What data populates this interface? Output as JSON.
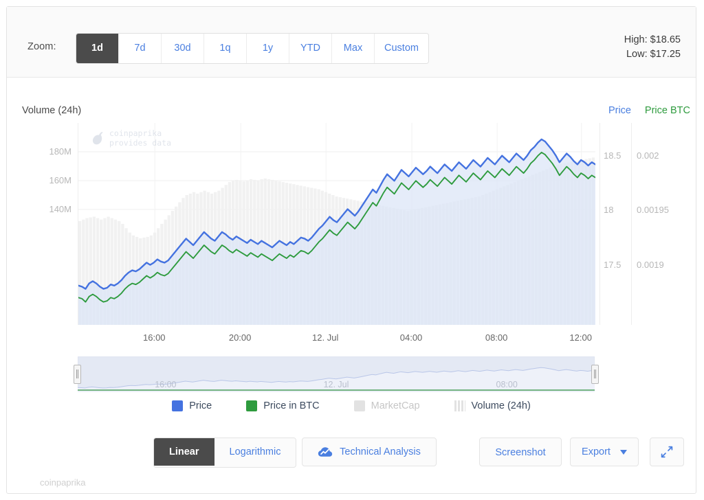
{
  "zoom_bar": {
    "label": "Zoom:",
    "ranges": [
      {
        "label": "1d",
        "active": true
      },
      {
        "label": "7d",
        "active": false
      },
      {
        "label": "30d",
        "active": false
      },
      {
        "label": "1q",
        "active": false
      },
      {
        "label": "1y",
        "active": false
      },
      {
        "label": "YTD",
        "active": false
      },
      {
        "label": "Max",
        "active": false
      },
      {
        "label": "Custom",
        "active": false
      }
    ],
    "high": "High: $18.65",
    "low": "Low: $17.25"
  },
  "chart_titles": {
    "volume_axis": "Volume (24h)",
    "price_axis": "Price",
    "price_btc_axis": "Price BTC"
  },
  "watermark": {
    "line1": "coinpaprika",
    "line2": "provides data"
  },
  "legend": [
    {
      "label": "Price",
      "color": "#4472e0",
      "type": "square",
      "disabled": false
    },
    {
      "label": "Price in BTC",
      "color": "#2e9b3e",
      "type": "square",
      "disabled": false
    },
    {
      "label": "MarketCap",
      "color": "#e2e2e2",
      "type": "square",
      "disabled": true
    },
    {
      "label": "Volume (24h)",
      "color": "#e2e2e2",
      "type": "bars",
      "disabled": false
    }
  ],
  "toolbar": {
    "scale_modes": [
      {
        "label": "Linear",
        "active": true
      },
      {
        "label": "Logarithmic",
        "active": false
      }
    ],
    "technical_analysis": "Technical Analysis",
    "screenshot": "Screenshot",
    "export": "Export",
    "fullscreen_icon": "expand-arrows-icon"
  },
  "credit": "coinpaprika",
  "chart_data": {
    "type": "line",
    "title": "",
    "xlabel": "",
    "grid": true,
    "legend_position": "bottom",
    "x_ticks": [
      "16:00",
      "20:00",
      "12. Jul",
      "04:00",
      "08:00",
      "12:00"
    ],
    "x_tick_positions": [
      0.148,
      0.314,
      0.479,
      0.645,
      0.81,
      0.973
    ],
    "axes": {
      "volume": {
        "label": "Volume (24h)",
        "ticks": [
          "140M",
          "160M",
          "180M"
        ],
        "tick_values": [
          140000000,
          160000000,
          180000000
        ],
        "range": [
          60000000,
          200000000
        ],
        "side": "left"
      },
      "price": {
        "label": "Price",
        "ticks": [
          "17.5",
          "18",
          "18.5"
        ],
        "tick_values": [
          17.5,
          18,
          18.5
        ],
        "range": [
          16.95,
          18.8
        ],
        "side": "right",
        "color": "#4472e0"
      },
      "price_btc": {
        "label": "Price BTC",
        "ticks": [
          "0.0019",
          "0.00195",
          "0.002"
        ],
        "tick_values": [
          0.0019,
          0.00195,
          0.002
        ],
        "range": [
          0.001845,
          0.00203
        ],
        "side": "right",
        "color": "#2e9b3e"
      }
    },
    "series": [
      {
        "name": "Price",
        "color": "#4472e0",
        "fill": "#dbe4f7",
        "unit": "USD",
        "values": [
          17.31,
          17.3,
          17.28,
          17.33,
          17.35,
          17.33,
          17.3,
          17.28,
          17.29,
          17.32,
          17.31,
          17.33,
          17.36,
          17.4,
          17.43,
          17.45,
          17.44,
          17.46,
          17.49,
          17.52,
          17.5,
          17.52,
          17.55,
          17.53,
          17.52,
          17.54,
          17.58,
          17.62,
          17.66,
          17.7,
          17.74,
          17.71,
          17.68,
          17.72,
          17.76,
          17.8,
          17.77,
          17.74,
          17.72,
          17.76,
          17.8,
          17.78,
          17.75,
          17.73,
          17.76,
          17.74,
          17.72,
          17.7,
          17.73,
          17.71,
          17.69,
          17.72,
          17.7,
          17.68,
          17.66,
          17.69,
          17.72,
          17.7,
          17.68,
          17.71,
          17.69,
          17.72,
          17.75,
          17.74,
          17.72,
          17.75,
          17.79,
          17.83,
          17.86,
          17.9,
          17.94,
          17.91,
          17.89,
          17.93,
          17.97,
          18.01,
          17.98,
          17.95,
          17.99,
          18.04,
          18.09,
          18.14,
          18.19,
          18.16,
          18.22,
          18.28,
          18.33,
          18.3,
          18.27,
          18.32,
          18.37,
          18.34,
          18.31,
          18.35,
          18.39,
          18.36,
          18.33,
          18.36,
          18.4,
          18.37,
          18.34,
          18.38,
          18.42,
          18.39,
          18.36,
          18.4,
          18.44,
          18.41,
          18.38,
          18.42,
          18.46,
          18.43,
          18.4,
          18.44,
          18.48,
          18.45,
          18.42,
          18.46,
          18.5,
          18.47,
          18.44,
          18.48,
          18.52,
          18.49,
          18.46,
          18.5,
          18.55,
          18.58,
          18.62,
          18.65,
          18.63,
          18.59,
          18.55,
          18.5,
          18.44,
          18.48,
          18.52,
          18.49,
          18.45,
          18.42,
          18.46,
          18.44,
          18.41,
          18.44,
          18.42
        ]
      },
      {
        "name": "Price in BTC",
        "color": "#2e9b3e",
        "unit": "BTC",
        "values": [
          0.00187,
          0.001869,
          0.001866,
          0.001871,
          0.001873,
          0.001871,
          0.001868,
          0.001866,
          0.001867,
          0.00187,
          0.001869,
          0.001871,
          0.001874,
          0.001878,
          0.001881,
          0.001883,
          0.001882,
          0.001884,
          0.001887,
          0.00189,
          0.001888,
          0.00189,
          0.001893,
          0.001891,
          0.00189,
          0.001892,
          0.001896,
          0.0019,
          0.001904,
          0.001908,
          0.001912,
          0.001909,
          0.001906,
          0.00191,
          0.001914,
          0.001918,
          0.001915,
          0.001912,
          0.00191,
          0.001914,
          0.001918,
          0.001916,
          0.001913,
          0.001911,
          0.001914,
          0.001912,
          0.00191,
          0.001908,
          0.001911,
          0.001909,
          0.001907,
          0.00191,
          0.001908,
          0.001906,
          0.001904,
          0.001907,
          0.00191,
          0.001908,
          0.001906,
          0.001909,
          0.001907,
          0.00191,
          0.001913,
          0.001912,
          0.00191,
          0.001913,
          0.001917,
          0.001921,
          0.001924,
          0.001928,
          0.001932,
          0.001929,
          0.001927,
          0.001931,
          0.001935,
          0.001939,
          0.001936,
          0.001933,
          0.001937,
          0.001942,
          0.001947,
          0.001952,
          0.001957,
          0.001954,
          0.00196,
          0.001966,
          0.001971,
          0.001968,
          0.001965,
          0.00197,
          0.001975,
          0.001972,
          0.001969,
          0.001973,
          0.001977,
          0.001974,
          0.001971,
          0.001974,
          0.001978,
          0.001975,
          0.001972,
          0.001976,
          0.00198,
          0.001977,
          0.001974,
          0.001978,
          0.001982,
          0.001979,
          0.001976,
          0.00198,
          0.001984,
          0.001981,
          0.001978,
          0.001982,
          0.001986,
          0.001983,
          0.00198,
          0.001984,
          0.001988,
          0.001985,
          0.001982,
          0.001986,
          0.00199,
          0.001987,
          0.001984,
          0.001988,
          0.001993,
          0.001996,
          0.002,
          0.002003,
          0.002001,
          0.001997,
          0.001993,
          0.001988,
          0.001982,
          0.001986,
          0.00199,
          0.001987,
          0.001983,
          0.00198,
          0.001984,
          0.001982,
          0.001979,
          0.001982,
          0.00198
        ]
      },
      {
        "name": "MarketCap",
        "color": "#ededed",
        "visible": false,
        "values": []
      },
      {
        "name": "Volume (24h)",
        "type": "bar",
        "color": "#f0f0f0",
        "values": [
          132000000,
          133000000,
          134000000,
          134500000,
          135000000,
          134000000,
          133000000,
          134000000,
          135000000,
          134000000,
          133000000,
          132000000,
          130000000,
          127000000,
          124000000,
          122000000,
          121000000,
          120000000,
          120500000,
          121000000,
          122000000,
          124000000,
          127000000,
          130000000,
          133000000,
          136000000,
          139000000,
          142000000,
          145000000,
          148000000,
          150000000,
          151000000,
          152000000,
          151000000,
          152000000,
          153000000,
          152000000,
          151000000,
          152000000,
          153000000,
          155000000,
          157000000,
          159000000,
          160000000,
          160500000,
          160000000,
          159500000,
          160000000,
          161000000,
          160500000,
          160000000,
          161000000,
          161500000,
          161000000,
          160500000,
          160000000,
          159500000,
          159000000,
          158500000,
          158000000,
          157500000,
          157000000,
          156500000,
          156000000,
          155500000,
          155000000,
          154500000,
          154000000,
          153000000,
          152000000,
          151000000,
          150000000,
          149000000,
          148500000,
          148000000,
          147500000,
          147000000,
          146500000,
          146000000,
          145500000,
          145000000,
          144500000,
          144000000,
          143500000,
          143000000,
          142500000,
          142000000,
          141500000,
          141000000,
          140500000,
          140000000,
          139500000,
          139000000,
          139500000,
          140000000,
          140500000,
          141000000,
          141500000,
          142000000,
          142500000,
          143000000,
          143500000,
          144000000,
          144500000,
          145000000,
          145500000,
          146000000,
          146500000,
          147000000,
          147500000,
          148000000,
          148500000,
          149000000,
          150000000,
          151000000,
          152000000,
          153000000,
          154000000,
          155000000,
          156000000,
          157000000,
          158000000,
          159000000,
          160000000,
          161000000,
          162000000,
          163000000,
          164000000,
          165000000,
          166000000,
          167000000,
          168000000,
          169000000,
          170000000,
          171000000,
          171500000,
          172000000,
          172500000,
          173000000,
          173500000,
          174000000,
          174500000,
          175000000,
          175500000,
          176000000
        ]
      }
    ],
    "navigator": {
      "x_ticks": [
        "16:00",
        "12. Jul",
        "08:00"
      ],
      "x_tick_positions": [
        0.17,
        0.5,
        0.83
      ],
      "selection": [
        0.0,
        1.0
      ]
    }
  }
}
